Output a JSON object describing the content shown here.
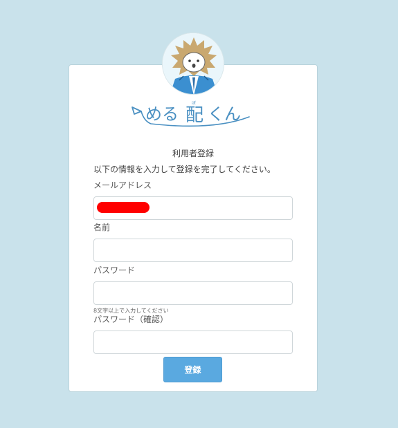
{
  "brand": {
    "logo_text": "めるぼ配くん",
    "accent_color": "#4a90c2"
  },
  "form": {
    "heading": "利用者登録",
    "description": "以下の情報を入力して登録を完了してください。",
    "fields": {
      "email": {
        "label": "メールアドレス",
        "value": "",
        "redacted": true
      },
      "name": {
        "label": "名前",
        "value": ""
      },
      "password": {
        "label": "パスワード",
        "value": "",
        "hint": "8文字以上で入力してください"
      },
      "password_confirm": {
        "label": "パスワード（確認）",
        "value": ""
      }
    },
    "submit_label": "登録"
  }
}
